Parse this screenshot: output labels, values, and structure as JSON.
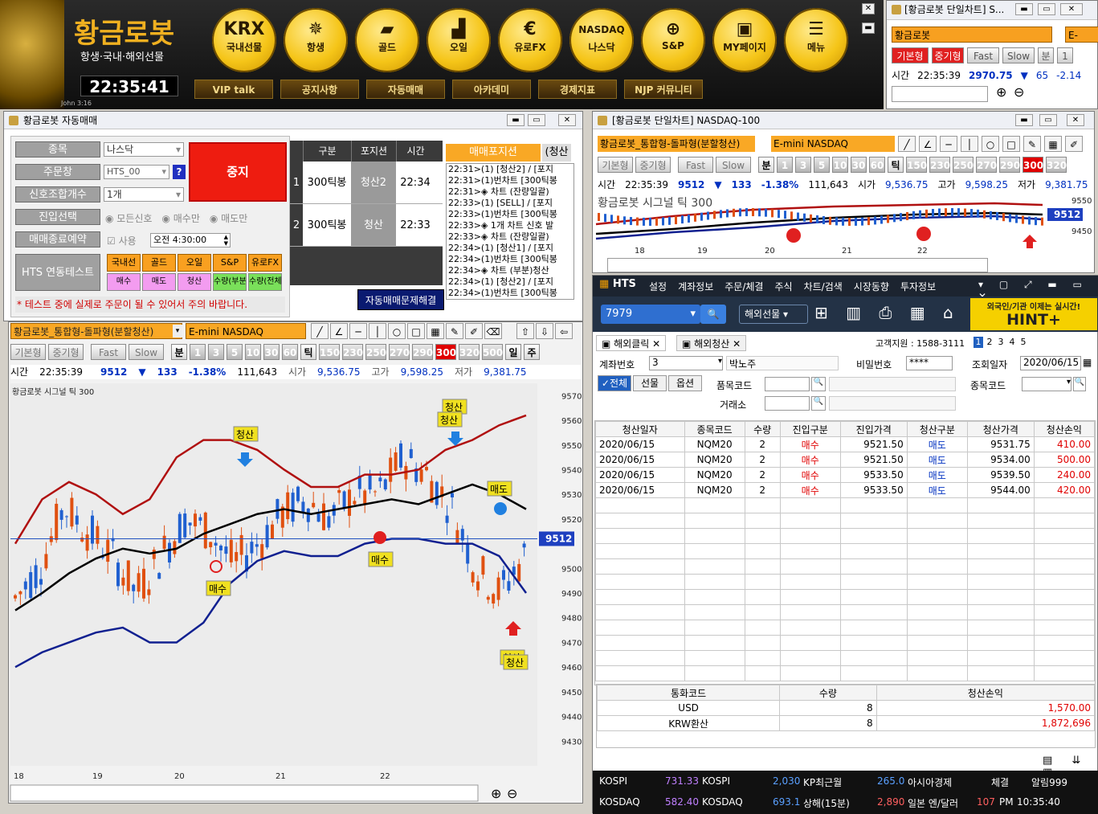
{
  "topbar": {
    "logo": "황금로봇",
    "tagline": "항생·국내·해외선물",
    "clock": "22:35:41",
    "watermark": "John 3:16",
    "buttons": [
      {
        "icon": "KRX",
        "label": "국내선물"
      },
      {
        "icon": "✵",
        "label": "항생"
      },
      {
        "icon": "▰",
        "label": "골드"
      },
      {
        "icon": "▟",
        "label": "오일"
      },
      {
        "icon": "€",
        "label": "유로FX"
      },
      {
        "icon": "NASDAQ",
        "label": "나스닥"
      },
      {
        "icon": "⊕",
        "label": "S&P"
      },
      {
        "icon": "▣",
        "label": "MY페이지"
      },
      {
        "icon": "☰",
        "label": "메뉴"
      }
    ],
    "sub": [
      "VIP talk",
      "공지사항",
      "자동매매",
      "아카데미",
      "경제지표",
      "NJP 커뮤니티"
    ]
  },
  "mini_chart": {
    "title": "[황금로봇 단일차트] S...",
    "symbol": "황금로봇",
    "product": "E-mini",
    "tabs": [
      "기본형",
      "중기형",
      "Fast",
      "Slow",
      "분",
      "1"
    ],
    "row": [
      "시간",
      "22:35:39",
      "2970.75",
      "▼",
      "65",
      "-2.14"
    ]
  },
  "auto": {
    "title": "황금로봇 자동매매",
    "labels": {
      "item": "종목",
      "account": "주문창",
      "signal": "신호조합개수",
      "entry": "진입선택",
      "endres": "매매종료예약",
      "test": "HTS 연동테스트"
    },
    "values": {
      "item": "나스닥",
      "account": "HTS_00",
      "signal": "1개",
      "stop": "중지",
      "q": "?",
      "entry_opts": [
        "모든신호",
        "매수만",
        "매도만"
      ],
      "use": "사용",
      "time": "오전  4:30:00"
    },
    "test_btns": [
      "국내선물",
      "골드",
      "오일",
      "S&P",
      "유로FX"
    ],
    "test_btns2": [
      "매수",
      "매도",
      "청산",
      "수량(부분)",
      "수량(전체)"
    ],
    "warning": "* 테스트 중에 실제로 주문이 될 수 있어서 주의 바랍니다.",
    "fix_btn": "자동매매문제해결",
    "table": {
      "headers": [
        "구분",
        "포지션",
        "시간"
      ],
      "rows": [
        [
          "1",
          "300틱봉",
          "청산2",
          "22:34"
        ],
        [
          "2",
          "300틱봉",
          "청산",
          "22:33"
        ]
      ]
    },
    "pos_tabs": [
      "매매포지션",
      "(청산"
    ],
    "log": [
      "22:31>(1) [청산2] / [포지",
      "22:31>(1)번차트 [300틱봉",
      "22:31>◈ 차트 (잔량일괄)",
      "22:33>(1) [SELL] / [포지",
      "22:33>(1)번차트 [300틱봉",
      "22:33>◈ 1개 차트 신호 발",
      "22:33>◈ 차트 (잔량일괄)",
      "22:34>(1) [청산1] / [포지",
      "22:34>(1)번차트 [300틱봉",
      "22:34>◈ 차트 (부분)청산",
      "22:34>(1) [청산2] / [포지",
      "22:34>(1)번차트 [300틱봉",
      "22:34>◈ 차트 (잔량일괄)"
    ]
  },
  "main_chart": {
    "strategy": "황금로봇_통합형-돌파형(분할청산)",
    "product": "E-mini NASDAQ",
    "tabs": [
      "기본형",
      "중기형",
      "Fast",
      "Slow",
      "분",
      "1",
      "3",
      "5",
      "10",
      "30",
      "60",
      "틱",
      "150",
      "230",
      "250",
      "270",
      "290",
      "300",
      "320",
      "500",
      "일",
      "주"
    ],
    "info": {
      "t": "시간",
      "time": "22:35:39",
      "price": "9512",
      "arrow": "▼",
      "chg": "133",
      "pct": "-1.38%",
      "vol": "111,643",
      "ol": "시가",
      "open": "9,536.75",
      "hl": "고가",
      "high": "9,598.25",
      "ll": "저가",
      "low": "9,381.75"
    },
    "title": "황금로봇 시그널  틱 300",
    "current": "9512",
    "marks": [
      "청산",
      "청산",
      "청산",
      "매도",
      "매수",
      "매수",
      "청산",
      "청산"
    ]
  },
  "chart_data": {
    "type": "candlestick",
    "title": "황금로봇 시그널 틱 300",
    "x": [
      "18",
      "19",
      "20",
      "21",
      "22"
    ],
    "ylim": [
      9420,
      9575
    ],
    "yticks": [
      9570,
      9560,
      9550,
      9540,
      9530,
      9520,
      9500,
      9490,
      9480,
      9470,
      9460,
      9450,
      9440,
      9430
    ],
    "current": 9512,
    "series": [
      {
        "name": "upper",
        "values": [
          9510,
          9528,
          9535,
          9530,
          9522,
          9528,
          9545,
          9552,
          9552,
          9548,
          9540,
          9533,
          9533,
          9538,
          9538,
          9540,
          9548,
          9552,
          9558,
          9562
        ]
      },
      {
        "name": "mid",
        "values": [
          9483,
          9490,
          9498,
          9504,
          9508,
          9506,
          9508,
          9514,
          9518,
          9522,
          9524,
          9522,
          9524,
          9526,
          9528,
          9526,
          9530,
          9534,
          9530,
          9524
        ]
      },
      {
        "name": "lower",
        "values": [
          9460,
          9466,
          9470,
          9474,
          9476,
          9470,
          9470,
          9478,
          9494,
          9503,
          9507,
          9505,
          9505,
          9510,
          9512,
          9512,
          9510,
          9510,
          9505,
          9490
        ]
      }
    ]
  },
  "nasdaq": {
    "title": "[황금로봇 단일차트] NASDAQ-100",
    "strategy": "황금로봇_통합형-돌파형(분할청산)",
    "product": "E-mini NASDAQ",
    "tabs": [
      "기본형",
      "중기형",
      "Fast",
      "Slow",
      "분",
      "1",
      "3",
      "5",
      "10",
      "30",
      "60",
      "틱",
      "150",
      "230",
      "250",
      "270",
      "290",
      "300",
      "320"
    ],
    "row": [
      "시간",
      "22:35:39",
      "9512",
      "▼",
      "133",
      "-1.38%",
      "111,643",
      "시가",
      "9,536.75",
      "고가",
      "9,598.25",
      "저가",
      "9,381.75"
    ],
    "chart_title": "황금로봇 시그널  틱 300",
    "price": "9512",
    "y": [
      "9550",
      "9450"
    ],
    "x": [
      "18",
      "19",
      "20",
      "21",
      "22"
    ]
  },
  "hts": {
    "logo": "HTS",
    "menu": [
      "설정",
      "계좌정보",
      "주문/체결",
      "주식",
      "차트/검색",
      "시장동향",
      "투자정보"
    ],
    "acct": "7979",
    "market": "해외선물",
    "banner1": "외국인/기관 이제는 실시간!",
    "banner2": "HINT+",
    "tabs": [
      "해외클릭",
      "해외청산"
    ],
    "support": "고객지원 : 1588-3111",
    "pages": [
      "1",
      "2",
      "3",
      "4",
      "5"
    ],
    "form": {
      "acct_l": "계좌번호",
      "acct": "3",
      "name": "박노주",
      "pw_l": "비밀번호",
      "pw": "****",
      "date_l": "조회일자",
      "date": "2020/06/15",
      "prod_l": "품목코드",
      "code_l": "종목코드",
      "ex_l": "거래소",
      "filter": [
        "✓전체",
        "선물",
        "옵션"
      ]
    },
    "headers": [
      "청산일자",
      "종목코드",
      "수량",
      "진입구분",
      "진입가격",
      "청산구분",
      "청산가격",
      "청산손익"
    ],
    "rows": [
      [
        "2020/06/15",
        "NQM20",
        "2",
        "매수",
        "9521.50",
        "매도",
        "9531.75",
        "410.00"
      ],
      [
        "2020/06/15",
        "NQM20",
        "2",
        "매수",
        "9521.50",
        "매도",
        "9534.00",
        "500.00"
      ],
      [
        "2020/06/15",
        "NQM20",
        "2",
        "매수",
        "9533.50",
        "매도",
        "9539.50",
        "240.00"
      ],
      [
        "2020/06/15",
        "NQM20",
        "2",
        "매수",
        "9533.50",
        "매도",
        "9544.00",
        "420.00"
      ]
    ],
    "sum_headers": [
      "통화코드",
      "수량",
      "청산손익"
    ],
    "sum_rows": [
      [
        "USD",
        "8",
        "1,570.00"
      ],
      [
        "KRW환산",
        "8",
        "1,872,696"
      ]
    ]
  },
  "ticker": {
    "r1": [
      "KOSPI",
      "731.33",
      "KOSPI",
      "2,030",
      "KP최근월",
      "265.0",
      "아시아경제",
      "체결",
      "알림999"
    ],
    "r2": [
      "KOSDAQ",
      "582.40",
      "KOSDAQ",
      "693.1",
      "상해(15분)",
      "2,890",
      "일본 엔/달러",
      "107",
      "PM",
      "10:35:40"
    ]
  }
}
